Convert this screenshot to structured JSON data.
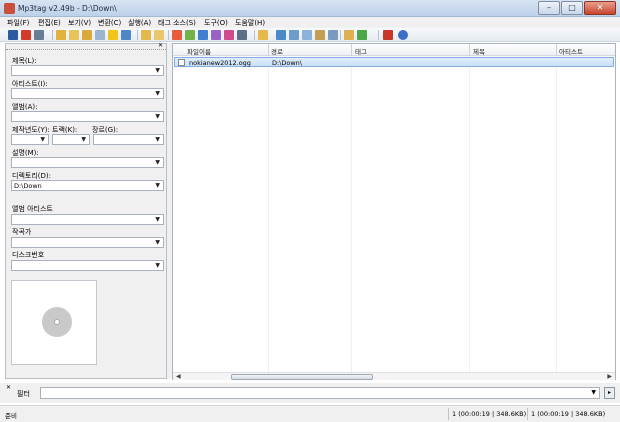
{
  "window": {
    "title": "Mp3tag v2.49b  -  D:\\Down\\",
    "min": "–",
    "max": "□",
    "close": "✕"
  },
  "menu": [
    "파일(F)",
    "편집(E)",
    "보기(V)",
    "변환(C)",
    "실행(A)",
    "태그 소스(S)",
    "도구(O)",
    "도움말(H)"
  ],
  "toolbar": {
    "icons": [
      "save-icon",
      "remove-tag-icon",
      "undo-icon",
      "change-dir-icon",
      "add-dir-icon",
      "open-folder-icon",
      "playlist-icon",
      "favorite-icon",
      "refresh-icon",
      "tag-to-filename-icon",
      "filename-to-tag-icon",
      "text-to-tag-icon",
      "tag-to-tag-icon",
      "actions-icon",
      "autonumber-icon",
      "case-icon",
      "options-icon",
      "export-icon",
      "web-source-icon",
      "freedb-icon",
      "musicbrainz-icon",
      "discogs-icon",
      "amazon-icon",
      "chart-icon",
      "help-icon"
    ]
  },
  "panel": {
    "title_label": "제목(L):",
    "title_value": "",
    "artist_label": "아티스트(I):",
    "artist_value": "",
    "album_label": "앨범(A):",
    "album_value": "",
    "year_label": "제작년도(Y):",
    "track_label": "트랙(K):",
    "genre_label": "장르(G):",
    "comment_label": "설명(M):",
    "comment_value": "",
    "dir_label": "디렉토리(D):",
    "dir_value": "D:\\Down",
    "album_artist_label": "앨범 아티스트",
    "album_artist_value": "",
    "composer_label": "작곡가",
    "composer_value": "",
    "disc_label": "디스크번호",
    "disc_value": ""
  },
  "list": {
    "columns": [
      "파일이름",
      "경로",
      "태그",
      "제목",
      "아티스트"
    ],
    "rows": [
      {
        "filename": "nokianew2012.ogg",
        "path": "D:\\Down\\"
      }
    ]
  },
  "filter": {
    "label": "필터",
    "value": ""
  },
  "status": {
    "ready": "준비",
    "selected": "1 (00:00:19 | 348.6KB)",
    "total": "1 (00:00:19 | 348.6KB)"
  },
  "colors": {
    "accent": "#c7e0fa",
    "titlebar": "#bcd1ea",
    "close": "#c7442c"
  }
}
